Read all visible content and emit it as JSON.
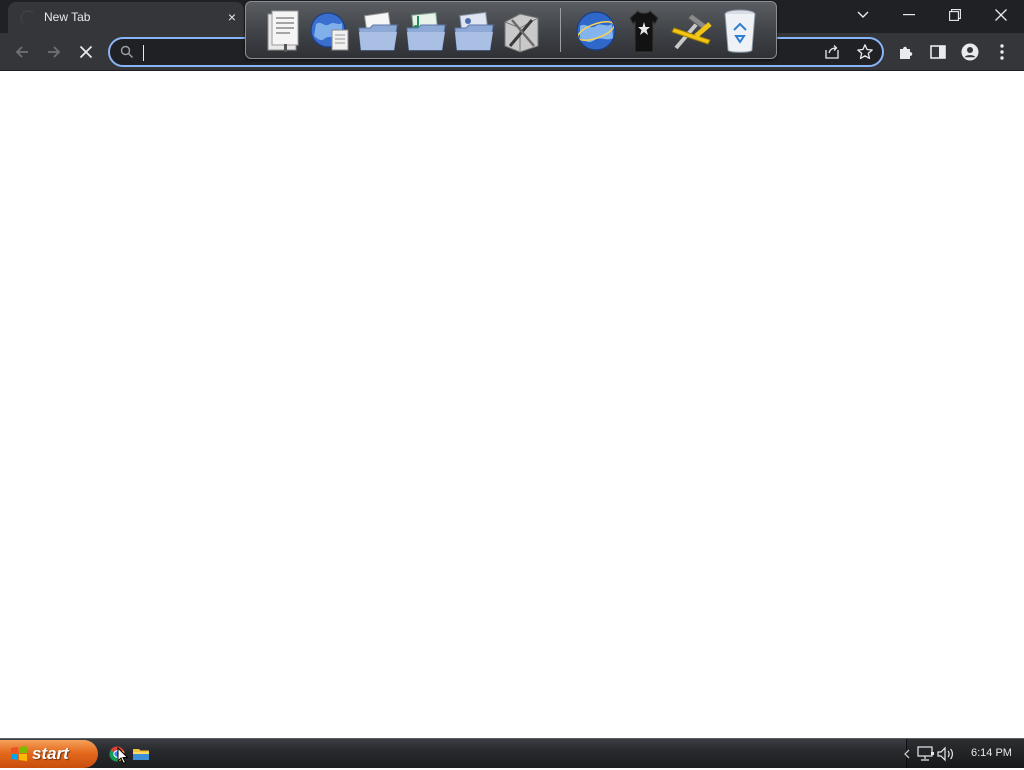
{
  "browser": {
    "tab": {
      "title": "New Tab",
      "close_glyph": "×"
    },
    "window_controls": [
      "tab-search-icon",
      "minimize-icon",
      "restore-icon",
      "close-icon"
    ],
    "toolbar": {
      "back_icon": "back-arrow-icon",
      "forward_icon": "forward-arrow-icon",
      "stop_icon": "stop-icon",
      "omnibox": {
        "value": "",
        "search_icon": "search-icon",
        "share_icon": "share-icon",
        "bookmark_icon": "star-icon"
      },
      "right_icons": [
        "extensions-icon",
        "side-panel-icon",
        "profile-icon",
        "menu-icon"
      ]
    },
    "accent_color": "#8ab4f8"
  },
  "dock": {
    "items": [
      "document-icon",
      "globe-document-icon",
      "documents-folder-icon",
      "music-folder-icon",
      "pictures-folder-icon",
      "utilities-icon",
      "internet-globe-icon",
      "tshirt-icon",
      "tools-icon",
      "recycle-bin-icon"
    ]
  },
  "taskbar": {
    "start_label": "start",
    "apps": [
      "chrome-taskbar-icon",
      "file-explorer-taskbar-icon"
    ],
    "tray": {
      "icons": [
        "tray-expand-icon",
        "network-icon",
        "volume-icon"
      ],
      "time": "6:14 PM"
    }
  }
}
